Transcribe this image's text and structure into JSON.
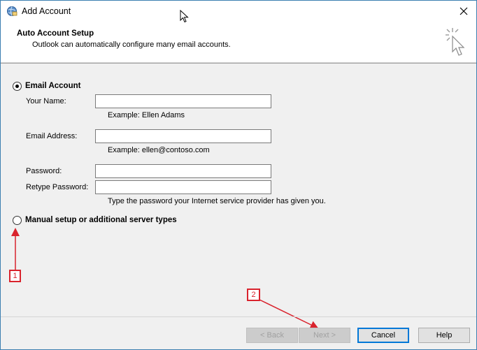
{
  "window": {
    "title": "Add Account"
  },
  "header": {
    "title": "Auto Account Setup",
    "subtitle": "Outlook can automatically configure many email accounts."
  },
  "email_account": {
    "label": "Email Account",
    "selected": true,
    "your_name": {
      "label": "Your Name:",
      "value": "",
      "example": "Example: Ellen Adams"
    },
    "email_address": {
      "label": "Email Address:",
      "value": "",
      "example": "Example: ellen@contoso.com"
    },
    "password": {
      "label": "Password:",
      "value": ""
    },
    "retype_password": {
      "label": "Retype Password:",
      "value": ""
    },
    "password_hint": "Type the password your Internet service provider has given you."
  },
  "manual_setup": {
    "label": "Manual setup or additional server types",
    "selected": false
  },
  "annotations": {
    "step1": "1",
    "step2": "2",
    "color": "#d9232d"
  },
  "buttons": {
    "back": "< Back",
    "next": "Next >",
    "cancel": "Cancel",
    "help": "Help"
  }
}
